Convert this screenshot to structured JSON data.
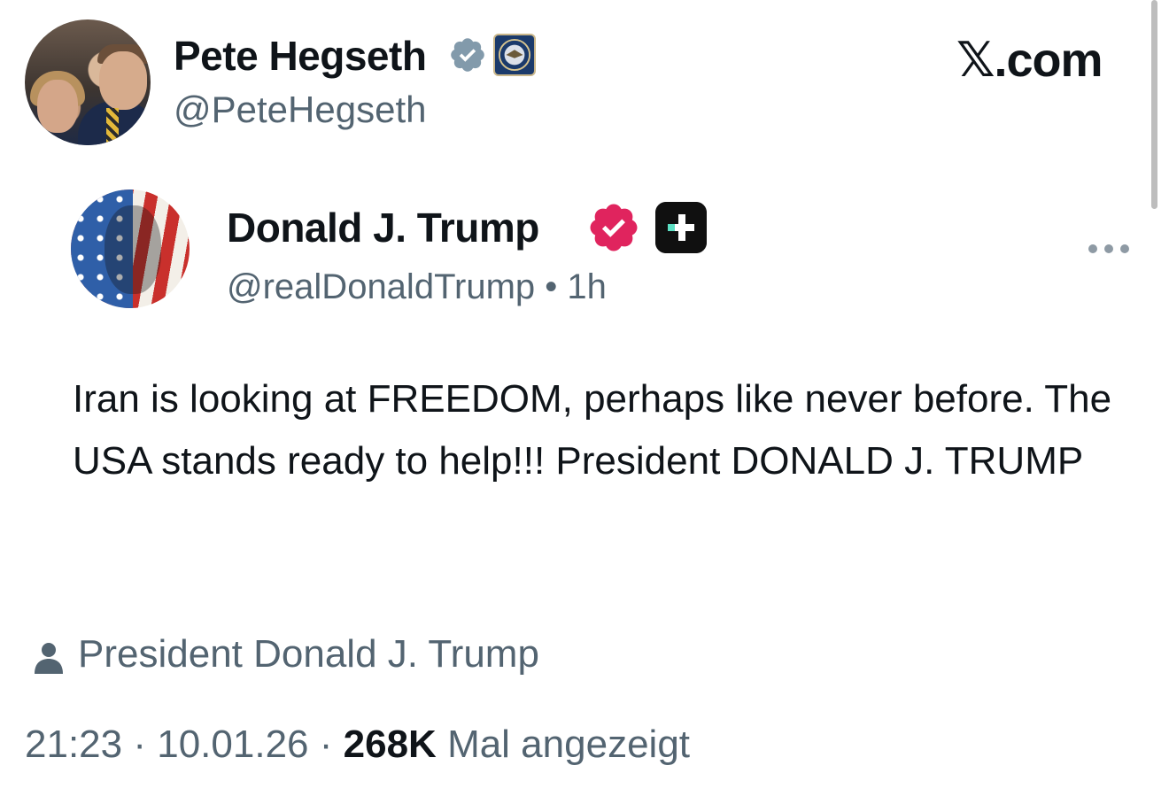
{
  "author": {
    "name": "Pete Hegseth",
    "handle": "@PeteHegseth"
  },
  "brand": {
    "label": "𝕏.com"
  },
  "embedded_post": {
    "name": "Donald J. Trump",
    "handle": "@realDonaldTrump",
    "separator": "•",
    "time": "1h",
    "text": "Iran is looking at FREEDOM, perhaps like never before. The USA stands ready to help!!! President DONALD J. TRUMP"
  },
  "attribution": {
    "label": "President Donald J. Trump"
  },
  "meta": {
    "time": "21:23",
    "dot1": "·",
    "date": "10.01.26",
    "dot2": "·",
    "views_count": "268K",
    "views_label": "Mal angezeigt"
  },
  "colors": {
    "verified_blue": "#829aab",
    "verified_red": "#e0245e",
    "secondary_text": "#536471",
    "primary_text": "#0f1419"
  },
  "icons": [
    "verified-badge-icon",
    "dod-seal-icon",
    "red-verified-badge-icon",
    "truth-social-plus-icon",
    "more-options-icon",
    "person-icon"
  ]
}
